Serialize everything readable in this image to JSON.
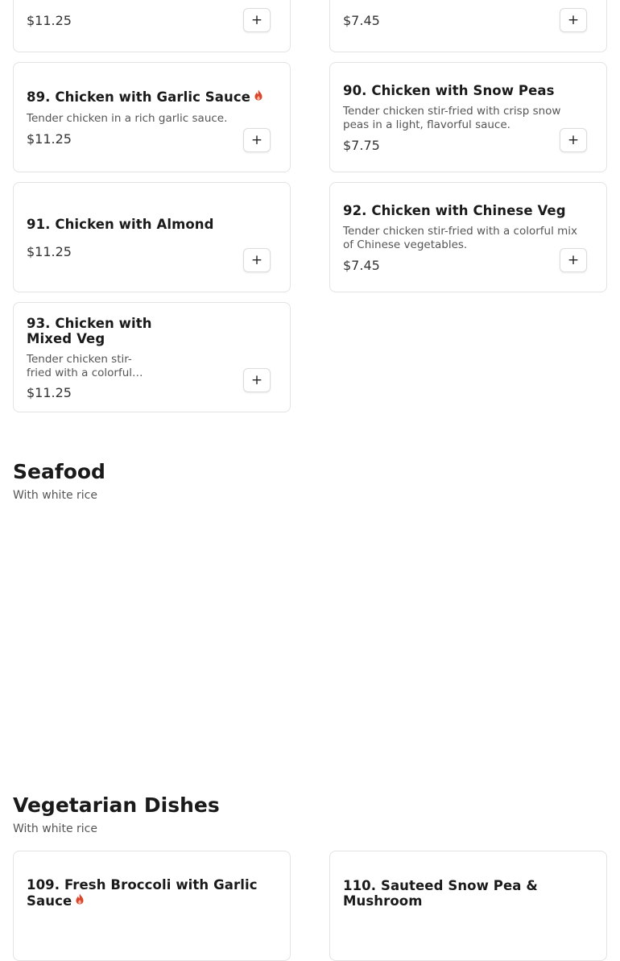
{
  "spicy_color": "#d9462b",
  "top_row": [
    {
      "price": "$11.25",
      "add_label": "+"
    },
    {
      "price": "$7.45",
      "add_label": "+"
    }
  ],
  "items": {
    "i89": {
      "name": "89. Chicken with Garlic Sauce",
      "spicy": true,
      "description": "Tender chicken in a rich garlic sauce.",
      "price": "$11.25",
      "add_label": "+"
    },
    "i90": {
      "name": "90. Chicken with Snow Peas",
      "description": "Tender chicken stir-fried with crisp snow peas in a light, flavorful sauce.",
      "price": "$7.75",
      "add_label": "+"
    },
    "i91": {
      "name": "91. Chicken with Almond",
      "price": "$11.25",
      "add_label": "+"
    },
    "i92": {
      "name": "92. Chicken with Chinese Veg",
      "description": "Tender chicken stir-fried with a colorful mix of Chinese vegetables.",
      "price": "$7.45",
      "add_label": "+"
    },
    "i93": {
      "name": "93. Chicken with Mixed Veg",
      "description": "Tender chicken stir-fried with a colorful…",
      "price": "$11.25",
      "add_label": "+"
    }
  },
  "sections": {
    "seafood": {
      "title": "Seafood",
      "subtitle": "With white rice"
    },
    "vegetarian": {
      "title": "Vegetarian Dishes",
      "subtitle": "With white rice"
    }
  },
  "vegetarian_items": {
    "i109": {
      "name": "109. Fresh Broccoli with Garlic Sauce",
      "spicy": true
    },
    "i110": {
      "name": "110. Sauteed Snow Pea & Mushroom"
    }
  }
}
